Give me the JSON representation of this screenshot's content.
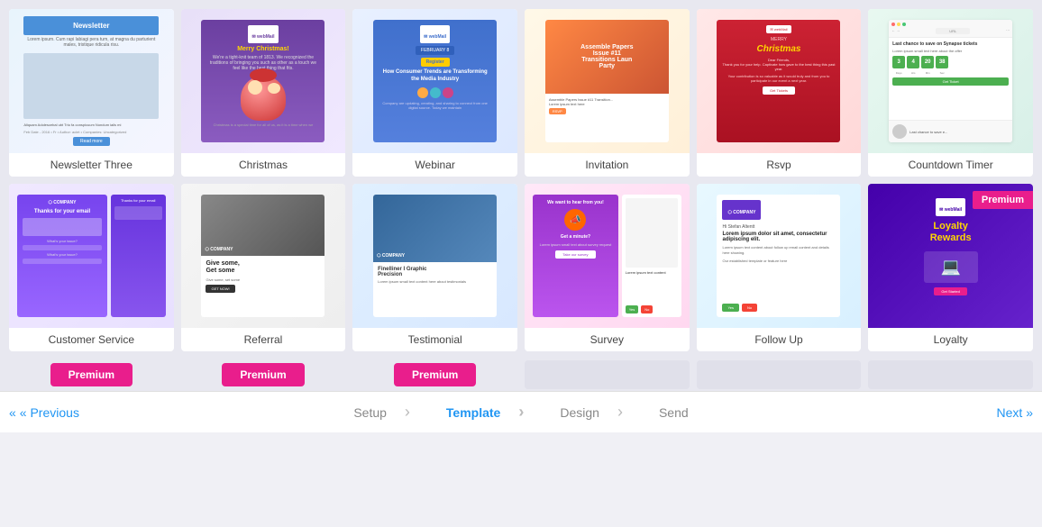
{
  "rows": [
    {
      "cards": [
        {
          "id": "newsletter-three",
          "label": "Newsletter Three",
          "bg": "#e8f4fc",
          "premium": false,
          "type": "newsletter"
        },
        {
          "id": "christmas",
          "label": "Christmas",
          "bg": "#e8e0f8",
          "premium": false,
          "type": "christmas"
        },
        {
          "id": "webinar",
          "label": "Webinar",
          "bg": "#e8f0ff",
          "premium": false,
          "type": "webinar"
        },
        {
          "id": "invitation",
          "label": "Invitation",
          "bg": "#fff8e8",
          "premium": false,
          "type": "invitation"
        },
        {
          "id": "rsvp",
          "label": "Rsvp",
          "bg": "#ffe8e8",
          "premium": false,
          "type": "rsvp"
        },
        {
          "id": "countdown-timer",
          "label": "Countdown Timer",
          "bg": "#e8f8f0",
          "premium": false,
          "type": "countdown"
        }
      ]
    },
    {
      "cards": [
        {
          "id": "customer-service",
          "label": "Customer Service",
          "bg": "#f0e8ff",
          "premium": false,
          "type": "customer"
        },
        {
          "id": "referral",
          "label": "Referral",
          "bg": "#f5f5f5",
          "premium": false,
          "type": "referral"
        },
        {
          "id": "testimonial",
          "label": "Testimonial",
          "bg": "#e0f0ff",
          "premium": false,
          "type": "testimonial"
        },
        {
          "id": "survey",
          "label": "Survey",
          "bg": "#ffe8f8",
          "premium": false,
          "type": "survey"
        },
        {
          "id": "follow-up",
          "label": "Follow Up",
          "bg": "#e8f8ff",
          "premium": false,
          "type": "followup"
        },
        {
          "id": "loyalty",
          "label": "Loyalty",
          "bg": "#4400aa",
          "premium": true,
          "type": "loyalty"
        }
      ]
    }
  ],
  "bottomPremium": [
    true,
    true,
    true,
    false,
    false,
    false
  ],
  "footer": {
    "prev": "« Previous",
    "next": "Next »",
    "steps": [
      "Setup",
      "Template",
      "Design",
      "Send"
    ],
    "activeStep": "Template"
  },
  "premiumLabel": "Premium"
}
